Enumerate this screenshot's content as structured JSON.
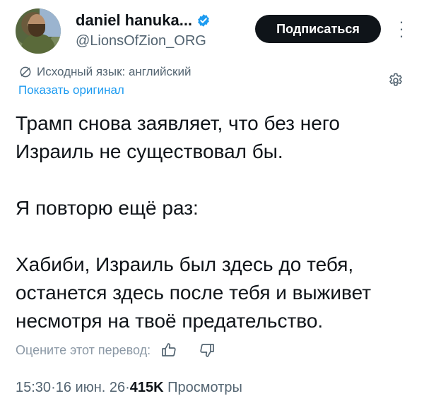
{
  "author": {
    "display_name": "daniel hanuka...",
    "handle": "@LionsOfZion_ORG",
    "verified": true
  },
  "actions": {
    "subscribe_label": "Подписаться",
    "more_icon": "more-vertical-icon"
  },
  "translation": {
    "source_language_text": "Исходный язык: английский",
    "show_original_label": "Показать оригинал",
    "settings_icon": "gear-icon"
  },
  "tweet": {
    "text": "Трамп снова заявляет, что без него\nИзраиль не существовал бы.\n\nЯ повторю ещё раз:\n\nХабиби, Израиль был здесь до тебя,\nостанется здесь после тебя и выживет\nнесмотря на твоё предательство."
  },
  "rating": {
    "prompt": "Оцените этот перевод:",
    "thumb_up_icon": "thumbs-up-icon",
    "thumb_down_icon": "thumbs-down-icon"
  },
  "meta": {
    "time": "15:30",
    "date": "16 июн. 26",
    "views_count": "415K",
    "views_label": "Просмотры",
    "separator": " · "
  },
  "colors": {
    "link": "#1d9bf0",
    "muted": "#536471",
    "verified": "#1d9bf0",
    "button_bg": "#0f1419"
  }
}
